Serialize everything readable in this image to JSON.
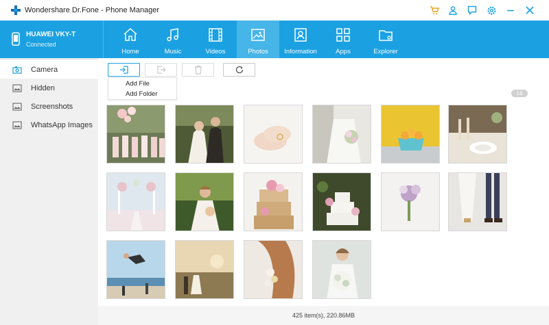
{
  "window": {
    "title": "Wondershare Dr.Fone - Phone Manager",
    "icons": [
      "cart-icon",
      "user-icon",
      "feedback-icon",
      "settings-icon",
      "minimize-icon",
      "close-icon"
    ],
    "accent": "#1ba1e2",
    "icon_color": "#1ba1e2",
    "cart_color": "#f0a020"
  },
  "device": {
    "name": "HUAWEI VKY-T",
    "status": "Connected"
  },
  "nav": {
    "tabs": [
      {
        "label": "Home",
        "icon": "home-icon"
      },
      {
        "label": "Music",
        "icon": "music-icon"
      },
      {
        "label": "Videos",
        "icon": "film-icon"
      },
      {
        "label": "Photos",
        "icon": "image-icon",
        "active": true
      },
      {
        "label": "Information",
        "icon": "contact-card-icon"
      },
      {
        "label": "Apps",
        "icon": "apps-grid-icon"
      },
      {
        "label": "Explorer",
        "icon": "folder-icon"
      }
    ]
  },
  "sidebar": {
    "items": [
      {
        "label": "Camera",
        "icon": "camera-icon",
        "active": true
      },
      {
        "label": "Hidden",
        "icon": "image-icon"
      },
      {
        "label": "Screenshots",
        "icon": "image-icon"
      },
      {
        "label": "WhatsApp Images",
        "icon": "image-icon"
      }
    ]
  },
  "toolbar": {
    "buttons": [
      {
        "name": "import",
        "icon": "import-icon"
      },
      {
        "name": "export",
        "icon": "export-icon",
        "disabled": true
      },
      {
        "name": "delete",
        "icon": "trash-icon",
        "disabled": true
      },
      {
        "name": "refresh",
        "icon": "refresh-icon"
      }
    ],
    "dropdown": {
      "items": [
        "Add File",
        "Add Folder"
      ]
    }
  },
  "album": {
    "count": "16"
  },
  "photos": [
    {
      "subject": "bridesmaids with balloons"
    },
    {
      "subject": "couple outdoors"
    },
    {
      "subject": "hands with rings"
    },
    {
      "subject": "bride with bouquet"
    },
    {
      "subject": "lemons in teal bowl"
    },
    {
      "subject": "table setting"
    },
    {
      "subject": "floral arch aisle"
    },
    {
      "subject": "bride in forest"
    },
    {
      "subject": "naked wedding cake"
    },
    {
      "subject": "tiered cake with flowers"
    },
    {
      "subject": "bouquet on white dress"
    },
    {
      "subject": "legs and shoes"
    },
    {
      "subject": "jumping on beach"
    },
    {
      "subject": "couple at sunset field"
    },
    {
      "subject": "bride braid flowers"
    },
    {
      "subject": "bride with white bouquet"
    }
  ],
  "status": {
    "text": "425 item(s), 220.86MB"
  }
}
